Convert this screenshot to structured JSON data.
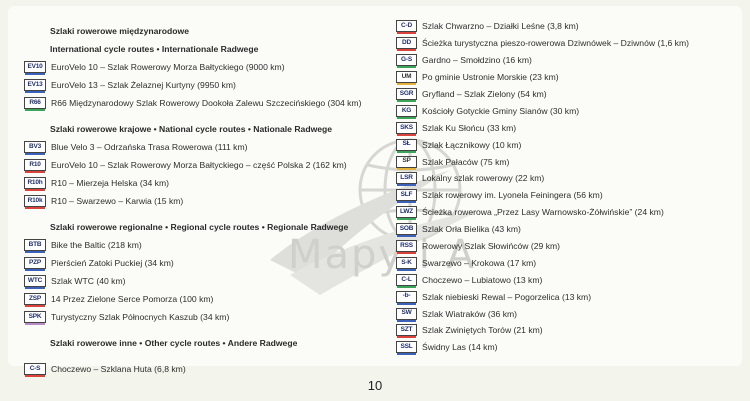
{
  "page_number": "10",
  "watermark": "Mapy i A",
  "left": {
    "h1": "Szlaki rowerowe międzynarodowe",
    "h1_sub": "International cycle routes • Internationale Radwege",
    "intl": [
      {
        "code": "EV10",
        "color": "#3b62b8",
        "label": "EuroVelo 10 – Szlak Rowerowy Morza Bałtyckiego (9000 km)"
      },
      {
        "code": "EV13",
        "color": "#3b62b8",
        "label": "EuroVelo 13 – Szlak Żelaznej Kurtyny (9950 km)"
      },
      {
        "code": "R66",
        "color": "#3aa45a",
        "label": "R66 Międzynarodowy Szlak Rowerowy Dookoła Zalewu Szczecińskiego (304 km)"
      }
    ],
    "h2": "Szlaki rowerowe krajowe • National cycle routes • Nationale Radwege",
    "national": [
      {
        "code": "BV3",
        "color": "#3b62b8",
        "label": "Blue Velo 3 – Odrzańska Trasa Rowerowa (111 km)"
      },
      {
        "code": "R10",
        "color": "#d8433c",
        "label": "EuroVelo 10 – Szlak Rowerowy Morza Bałtyckiego – część Polska 2 (162 km)"
      },
      {
        "code": "R10h",
        "color": "#d8433c",
        "label": "R10 – Mierzeja Helska (34 km)"
      },
      {
        "code": "R10k",
        "color": "#d8433c",
        "label": "R10 – Swarzewo – Karwia (15 km)"
      }
    ],
    "h3": "Szlaki rowerowe regionalne • Regional cycle routes • Regionale Radwege",
    "regional": [
      {
        "code": "BTB",
        "color": "#3b62b8",
        "label": "Bike the Baltic (218 km)"
      },
      {
        "code": "PZP",
        "color": "#3b62b8",
        "label": "Pierścień Zatoki Puckiej (34 km)"
      },
      {
        "code": "WTC",
        "color": "#3b62b8",
        "label": "Szlak WTC (40 km)"
      },
      {
        "code": "ZSP",
        "color": "#d8433c",
        "label": "14 Przez Zielone Serce Pomorza (100 km)"
      },
      {
        "code": "SPK",
        "color": "#b98ac6",
        "label": "Turystyczny Szlak Północnych Kaszub (34 km)"
      }
    ],
    "h4": "Szlaki rowerowe inne • Other cycle routes • Andere Radwege",
    "other": [
      {
        "code": "C-S",
        "color": "#d8433c",
        "label": "Choczewo – Szklana Huta (6,8 km)"
      }
    ]
  },
  "right": [
    {
      "code": "C-D",
      "color": "#d8433c",
      "label": "Szlak Chwarzno – Działki Leśne (3,8 km)"
    },
    {
      "code": "DD",
      "color": "#d8433c",
      "label": "Ścieżka turystyczna pieszo-rowerowa Dziwnówek – Dziwnów (1,6 km)"
    },
    {
      "code": "G-S",
      "color": "#3aa45a",
      "label": "Gardno – Smołdzino (16 km)"
    },
    {
      "code": "UM",
      "color": "#e3b23c",
      "label": "Po gminie Ustronie Morskie (23 km)"
    },
    {
      "code": "SGR",
      "color": "#3aa45a",
      "label": "Gryfland – Szlak Zielony (54 km)"
    },
    {
      "code": "KG",
      "color": "#3aa45a",
      "label": "Kościoły Gotyckie Gminy Sianów (30 km)"
    },
    {
      "code": "SKS",
      "color": "#d8433c",
      "label": "Szlak Ku Słońcu (33 km)"
    },
    {
      "code": "SŁ",
      "color": "#3aa45a",
      "label": "Szlak Łącznikowy (10 km)"
    },
    {
      "code": "SP",
      "color": "#e3b23c",
      "label": "Szlak Pałaców (75 km)"
    },
    {
      "code": "LSR",
      "color": "#3b62b8",
      "label": "Lokalny szlak rowerowy (22 km)"
    },
    {
      "code": "SLF",
      "color": "#3b62b8",
      "label": "Szlak rowerowy im. Lyonela Feiningera (56 km)"
    },
    {
      "code": "LWZ",
      "color": "#3aa45a",
      "label": "Ścieżka rowerowa „Przez Lasy Warnowsko-Żółwińskie” (24 km)"
    },
    {
      "code": "SOB",
      "color": "#3b62b8",
      "label": "Szlak Orła Bielika (43 km)"
    },
    {
      "code": "RSS",
      "color": "#d8433c",
      "label": "Rowerowy Szlak Słowińców (29 km)"
    },
    {
      "code": "S-K",
      "color": "#3b62b8",
      "label": "Swarzewo – Krokowa (17 km)"
    },
    {
      "code": "C-L",
      "color": "#3aa45a",
      "label": "Choczewo – Lubiatowo (13 km)"
    },
    {
      "code": "-b-",
      "color": "#3b62b8",
      "label": "Szlak niebieski Rewal – Pogorzelica (13 km)"
    },
    {
      "code": "SW",
      "color": "#3b62b8",
      "label": "Szlak Wiatraków (36 km)"
    },
    {
      "code": "SZT",
      "color": "#d8433c",
      "label": "Szlak Zwiniętych Torów (21 km)"
    },
    {
      "code": "SSL",
      "color": "#3b62b8",
      "label": "Świdny Las (14 km)"
    }
  ]
}
